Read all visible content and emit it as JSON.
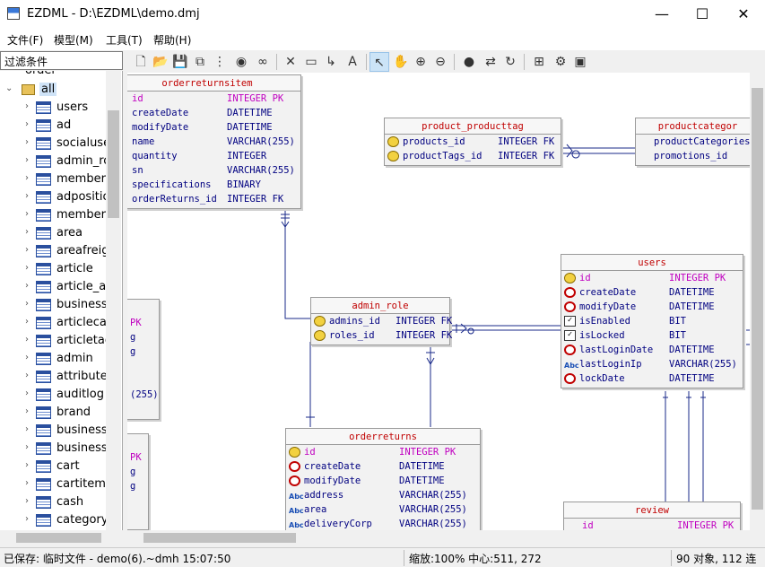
{
  "window": {
    "title": "EZDML - D:\\EZDML\\demo.dmj",
    "minimize": "—",
    "maximize": "☐",
    "close": "✕"
  },
  "menu": {
    "file": "文件(F)",
    "model": "模型(M)",
    "tools": "工具(T)",
    "help": "帮助(H)"
  },
  "filter": {
    "placeholder": "过滤条件"
  },
  "tree": {
    "root_partial": "order",
    "root": "all",
    "items": [
      "users",
      "ad",
      "socialuser",
      "admin_ro",
      "memberra",
      "adpositio",
      "member",
      "area",
      "areafreigl",
      "article",
      "article_art",
      "business",
      "articlecate",
      "articletag",
      "admin",
      "attribute",
      "auditlog",
      "brand",
      "businessa",
      "businessc",
      "cart",
      "cartitem",
      "cash",
      "categorya"
    ]
  },
  "toolbar": {
    "icons": [
      "new-icon",
      "open-icon",
      "save-icon",
      "copy-icon",
      "tree-icon",
      "globe-icon",
      "find-icon",
      "delete-icon",
      "table-icon",
      "link-icon",
      "text-icon",
      "pointer-icon",
      "hand-icon",
      "zoom-in-icon",
      "zoom-out-icon",
      "script-icon",
      "export-icon",
      "refresh-icon",
      "add-icon",
      "settings-icon",
      "image-icon"
    ]
  },
  "entities": {
    "orderreturnsitem": {
      "title": "orderreturnsitem",
      "rows": [
        {
          "name": "id",
          "type": "INTEGER PK",
          "pk": true
        },
        {
          "name": "createDate",
          "type": "DATETIME"
        },
        {
          "name": "modifyDate",
          "type": "DATETIME"
        },
        {
          "name": "name",
          "type": "VARCHAR(255)"
        },
        {
          "name": "quantity",
          "type": "INTEGER"
        },
        {
          "name": "sn",
          "type": "VARCHAR(255)"
        },
        {
          "name": "specifications",
          "type": "BINARY"
        },
        {
          "name": "orderReturns_id",
          "type": "INTEGER FK"
        }
      ]
    },
    "product_producttag": {
      "title": "product_producttag",
      "rows": [
        {
          "name": "products_id",
          "type": "INTEGER FK"
        },
        {
          "name": "productTags_id",
          "type": "INTEGER FK"
        }
      ]
    },
    "productcategory": {
      "title": "productcategor",
      "rows": [
        {
          "name": "productCategories_",
          "type": ""
        },
        {
          "name": "promotions_id",
          "type": ""
        }
      ]
    },
    "admin_role": {
      "title": "admin_role",
      "rows": [
        {
          "name": "admins_id",
          "type": "INTEGER FK"
        },
        {
          "name": "roles_id",
          "type": "INTEGER FK"
        }
      ]
    },
    "users": {
      "title": "users",
      "rows": [
        {
          "name": "id",
          "type": "INTEGER PK",
          "pk": true
        },
        {
          "name": "createDate",
          "type": "DATETIME"
        },
        {
          "name": "modifyDate",
          "type": "DATETIME"
        },
        {
          "name": "isEnabled",
          "type": "BIT"
        },
        {
          "name": "isLocked",
          "type": "BIT"
        },
        {
          "name": "lastLoginDate",
          "type": "DATETIME"
        },
        {
          "name": "lastLoginIp",
          "type": "VARCHAR(255)"
        },
        {
          "name": "lockDate",
          "type": "DATETIME"
        }
      ]
    },
    "orderreturns": {
      "title": "orderreturns",
      "rows": [
        {
          "name": "id",
          "type": "INTEGER PK",
          "pk": true
        },
        {
          "name": "createDate",
          "type": "DATETIME"
        },
        {
          "name": "modifyDate",
          "type": "DATETIME"
        },
        {
          "name": "address",
          "type": "VARCHAR(255)"
        },
        {
          "name": "area",
          "type": "VARCHAR(255)"
        },
        {
          "name": "deliveryCorp",
          "type": "VARCHAR(255)"
        }
      ]
    },
    "review": {
      "title": "review",
      "rows": [
        {
          "name": "id",
          "type": "INTEGER PK",
          "pk": true
        }
      ]
    },
    "partial_left_a": {
      "rows": [
        "PK",
        "g",
        "g",
        "(255)"
      ]
    },
    "partial_left_b": {
      "rows": [
        "PK",
        "g",
        "g"
      ]
    }
  },
  "status": {
    "saved": "已保存: 临时文件 - demo(6).~dmh 15:07:50",
    "zoom": "缩放:100% 中心:511, 272",
    "count": "90 对象, 112 连"
  }
}
